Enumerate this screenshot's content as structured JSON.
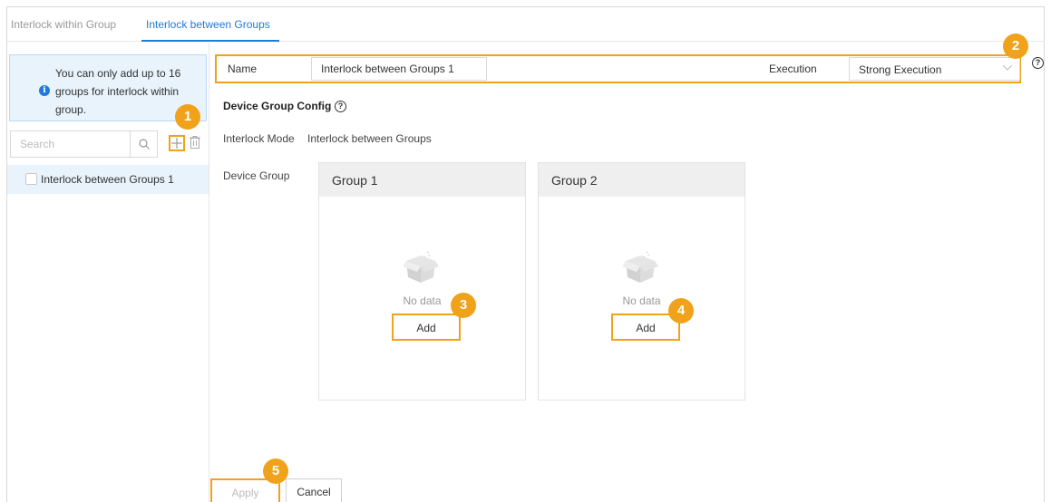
{
  "tabs": {
    "within": "Interlock within Group",
    "between": "Interlock between Groups"
  },
  "sidebar": {
    "notice_line1": "You can only add up to 16",
    "notice_line2": "groups for interlock within",
    "notice_line3": "group.",
    "search_placeholder": "Search",
    "items": [
      {
        "label": "Interlock between Groups 1",
        "checked": false
      }
    ]
  },
  "form": {
    "name_label": "Name",
    "name_value": "Interlock between Groups 1",
    "execution_label": "Execution",
    "execution_value": "Strong Execution"
  },
  "config": {
    "section_title": "Device Group Config",
    "mode_label": "Interlock Mode",
    "mode_value": "Interlock between Groups",
    "device_group_label": "Device Group",
    "groups": [
      {
        "title": "Group 1",
        "empty_text": "No data",
        "add_label": "Add"
      },
      {
        "title": "Group 2",
        "empty_text": "No data",
        "add_label": "Add"
      }
    ]
  },
  "footer": {
    "apply_label": "Apply",
    "cancel_label": "Cancel"
  },
  "callouts": [
    "1",
    "2",
    "3",
    "4",
    "5"
  ],
  "colors": {
    "accent": "#1e7bd9",
    "highlight": "#f0a21b",
    "notice_bg": "#e8f3fc"
  }
}
